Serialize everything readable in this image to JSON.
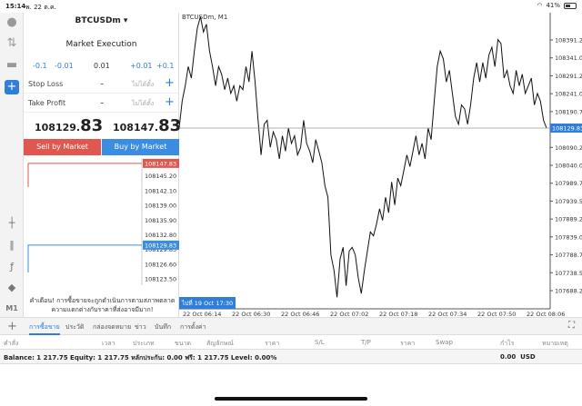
{
  "status": {
    "time": "15:14",
    "date": "พ. 22 ต.ค.",
    "battery": "41%"
  },
  "panel": {
    "symbol": "BTCUSDm ▾",
    "execution": "Market Execution",
    "volume_steps": [
      "-0.1",
      "-0.01",
      "0.01",
      "+0.01",
      "+0.1"
    ],
    "stop_loss": {
      "label": "Stop Loss",
      "minus": "-",
      "placeholder": "ไม่ได้ตั้ง",
      "plus": "+"
    },
    "take_profit": {
      "label": "Take Profit",
      "minus": "-",
      "placeholder": "ไม่ได้ตั้ง",
      "plus": "+"
    },
    "bid_main": "108129.",
    "bid_big": "83",
    "ask_main": "108147.",
    "ask_big": "83",
    "sell_label": "Sell by Market",
    "buy_label": "Buy by Market",
    "mini_prices": [
      "108147.83",
      "108145.20",
      "108142.10",
      "108139.00",
      "108135.90",
      "108132.80",
      "108129.83",
      "108126.60",
      "108123.50"
    ],
    "warning": "คำเตือน! การซื้อขายจะถูกดำเนินการตามสภาพตลาด ความแตกต่างกับราคาที่ส่งอาจมีมาก!"
  },
  "chart": {
    "title": "BTCUSDm, M1",
    "y_labels": [
      "108391.25",
      "108341.00",
      "108291.25",
      "108241.00",
      "108190.75",
      "108140.50",
      "108090.25",
      "108040.00",
      "107989.75",
      "107939.50",
      "107889.25",
      "107839.00",
      "107788.75",
      "107738.50",
      "107688.25"
    ],
    "current_price": "108129.83",
    "x_labels": [
      "22 Oct 06:14",
      "22 Oct 06:30",
      "22 Oct 06:46",
      "22 Oct 07:02",
      "22 Oct 07:18",
      "22 Oct 07:34",
      "22 Oct 07:50",
      "22 Oct 08:06"
    ],
    "cursor_time": "ไปที่ 19 Oct 17:30",
    "accent": "#2f7ed8"
  },
  "chart_data": {
    "type": "line",
    "title": "BTCUSDm, M1",
    "ylim": [
      107660,
      108430
    ],
    "values": [
      108130,
      108200,
      108240,
      108290,
      108260,
      108330,
      108390,
      108420,
      108380,
      108400,
      108330,
      108290,
      108240,
      108290,
      108270,
      108230,
      108260,
      108220,
      108240,
      108200,
      108240,
      108230,
      108290,
      108250,
      108330,
      108250,
      108150,
      108060,
      108140,
      108150,
      108080,
      108120,
      108100,
      108050,
      108110,
      108070,
      108130,
      108090,
      108110,
      108060,
      108080,
      108150,
      108090,
      108070,
      108040,
      108100,
      108070,
      108040,
      107980,
      107950,
      107800,
      107760,
      107690,
      107790,
      107820,
      107720,
      107810,
      107820,
      107800,
      107740,
      107700,
      107760,
      107810,
      107860,
      107850,
      107880,
      107920,
      107890,
      107950,
      107910,
      107990,
      107930,
      108000,
      107980,
      108020,
      108060,
      108030,
      108070,
      108110,
      108060,
      108090,
      108050,
      108130,
      108100,
      108200,
      108290,
      108330,
      108310,
      108250,
      108280,
      108220,
      108160,
      108140,
      108190,
      108180,
      108140,
      108190,
      108260,
      108300,
      108250,
      108300,
      108260,
      108320,
      108340,
      108290,
      108360,
      108350,
      108260,
      108280,
      108240,
      108220,
      108280,
      108240,
      108270,
      108220,
      108240,
      108260,
      108190,
      108220,
      108200,
      108150,
      108130
    ]
  },
  "mini_chart": {
    "ask_level": 108147.83,
    "bid_level": 108129.83,
    "range": [
      108121,
      108149
    ]
  },
  "bottom": {
    "tabs": [
      "การซื้อขาย",
      "ประวัติ",
      "กล่องจดหมาย",
      "ข่าว",
      "บันทึก",
      "การตั้งค่า"
    ],
    "headers": [
      "คำสั่ง",
      "เวลา",
      "ประเภท",
      "ขนาด",
      "สัญลักษณ์",
      "ราคา",
      "S/L",
      "T/P",
      "ราคา",
      "Swap",
      "กำไร",
      "หมายเหตุ"
    ],
    "balance_text": "Balance: 1 217.75 Equity: 1 217.75 หลักประกัน: 0.00 ฟรี: 1 217.75 Level: 0.00%",
    "profit": "0.00",
    "currency": "USD"
  },
  "colors": {
    "sell": "#e0574f",
    "buy": "#3a8de0",
    "ask_line": "#e0574f",
    "bid_line": "#3a8de0"
  }
}
